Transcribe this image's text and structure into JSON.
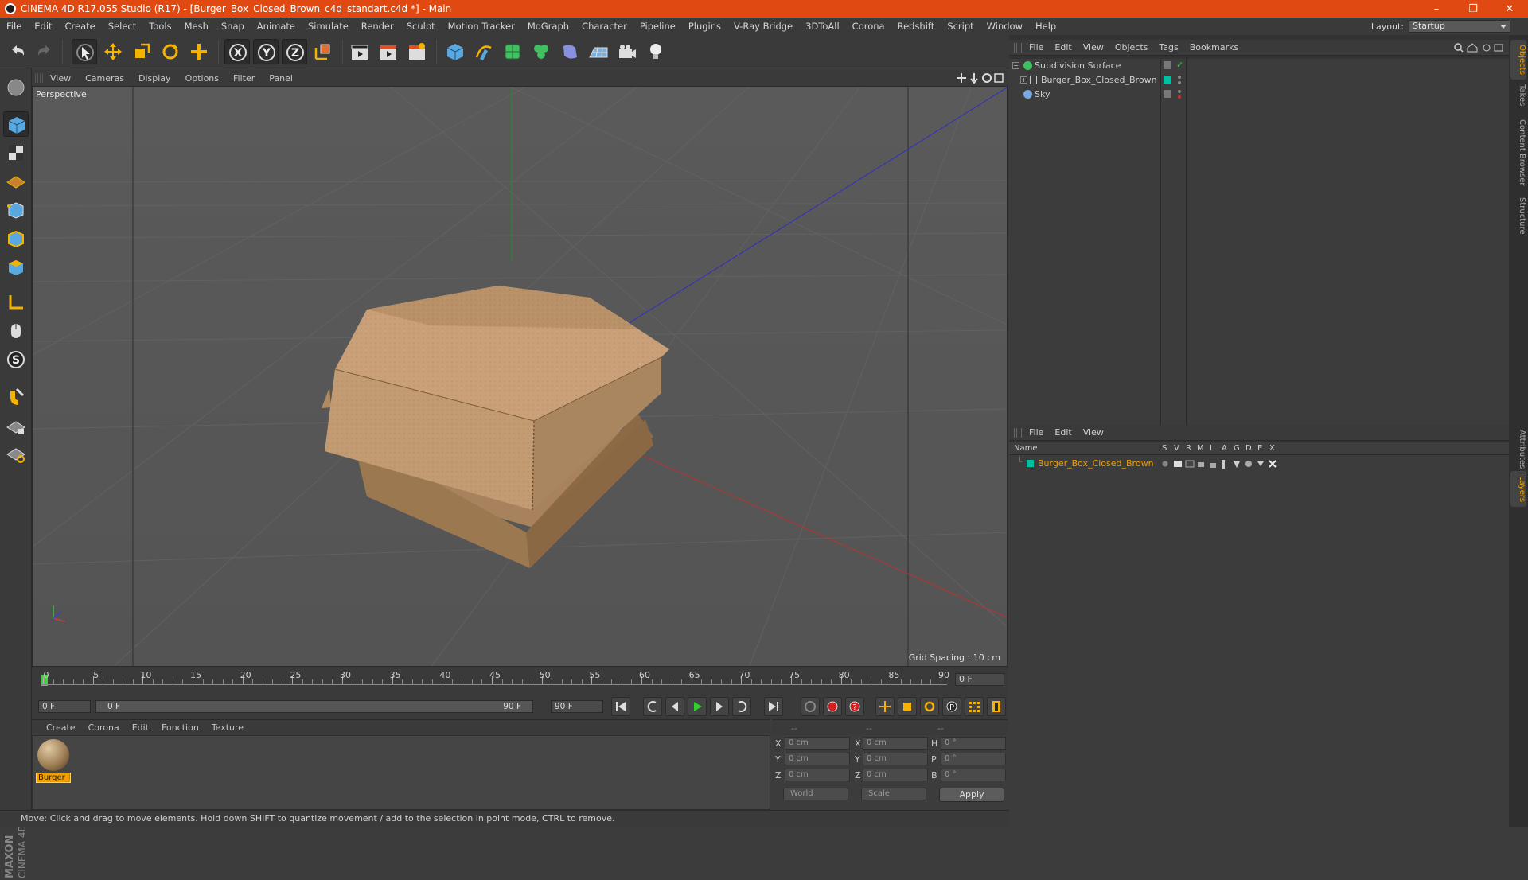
{
  "window": {
    "title": "CINEMA 4D R17.055 Studio (R17) - [Burger_Box_Closed_Brown_c4d_standart.c4d *] - Main",
    "controls": {
      "minimize": "–",
      "restore": "❐",
      "close": "✕"
    }
  },
  "menubar": {
    "items": [
      "File",
      "Edit",
      "Create",
      "Select",
      "Tools",
      "Mesh",
      "Snap",
      "Animate",
      "Simulate",
      "Render",
      "Sculpt",
      "Motion Tracker",
      "MoGraph",
      "Character",
      "Pipeline",
      "Plugins",
      "V-Ray Bridge",
      "3DToAll",
      "Corona",
      "Redshift",
      "Script",
      "Window",
      "Help"
    ],
    "layout_label": "Layout:",
    "layout_value": "Startup"
  },
  "viewport": {
    "menu": [
      "View",
      "Cameras",
      "Display",
      "Options",
      "Filter",
      "Panel"
    ],
    "label": "Perspective",
    "grid_spacing": "Grid Spacing : 10 cm"
  },
  "timeline": {
    "ticks": [
      "0",
      "5",
      "10",
      "15",
      "20",
      "25",
      "30",
      "35",
      "40",
      "45",
      "50",
      "55",
      "60",
      "65",
      "70",
      "75",
      "80",
      "85",
      "90"
    ],
    "current_frame": "0 F"
  },
  "transport": {
    "start_frame": "0 F",
    "range_start": "0 F",
    "range_end": "90 F",
    "end_frame": "90 F"
  },
  "material_manager": {
    "menu": [
      "Create",
      "Corona",
      "Edit",
      "Function",
      "Texture"
    ],
    "materials": [
      {
        "name": "Burger_I"
      }
    ]
  },
  "coordinates": {
    "headers": [
      "--",
      "--",
      "--"
    ],
    "rows": [
      {
        "l1": "X",
        "v1": "0 cm",
        "l2": "X",
        "v2": "0 cm",
        "l3": "H",
        "v3": "0 °"
      },
      {
        "l1": "Y",
        "v1": "0 cm",
        "l2": "Y",
        "v2": "0 cm",
        "l3": "P",
        "v3": "0 °"
      },
      {
        "l1": "Z",
        "v1": "0 cm",
        "l2": "Z",
        "v2": "0 cm",
        "l3": "B",
        "v3": "0 °"
      }
    ],
    "space": "World",
    "mode": "Scale",
    "apply": "Apply"
  },
  "status": "Move: Click and drag to move elements. Hold down SHIFT to quantize movement / add to the selection in point mode, CTRL to remove.",
  "branding": {
    "maxon": "MAXON",
    "product": "CINEMA 4D"
  },
  "object_manager": {
    "menu": [
      "File",
      "Edit",
      "View",
      "Objects",
      "Tags",
      "Bookmarks"
    ],
    "objects": [
      {
        "name": "Subdivision Surface"
      },
      {
        "name": "Burger_Box_Closed_Brown"
      },
      {
        "name": "Sky"
      }
    ]
  },
  "layer_manager": {
    "menu": [
      "File",
      "Edit",
      "View"
    ],
    "columns": [
      "Name",
      "S",
      "V",
      "R",
      "M",
      "L",
      "A",
      "G",
      "D",
      "E",
      "X"
    ],
    "layers": [
      {
        "name": "Burger_Box_Closed_Brown",
        "color": "#00c0a0"
      }
    ]
  },
  "right_tabs": {
    "top": [
      "Objects",
      "Takes",
      "Content Browser",
      "Structure"
    ],
    "bottom": [
      "Attributes",
      "Layers"
    ]
  },
  "colors": {
    "title_bar": "#e04a12",
    "accent_orange": "#f0a000",
    "layer_teal": "#00c0a0"
  }
}
